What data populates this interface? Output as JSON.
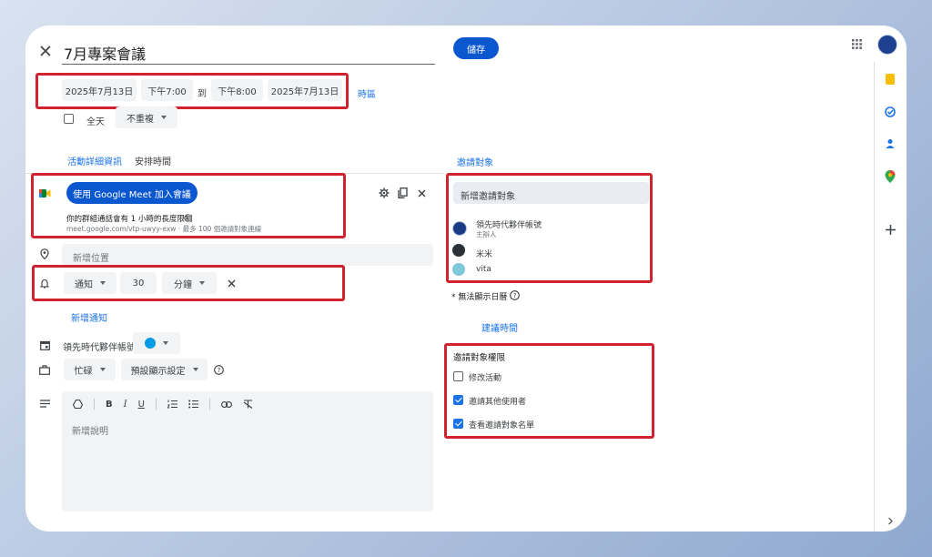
{
  "header": {
    "title": "7月專案會議",
    "save_label": "儲存"
  },
  "datetime": {
    "start_date": "2025年7月13日",
    "start_time": "下午7:00",
    "to_label": "到",
    "end_time": "下午8:00",
    "end_date": "2025年7月13日",
    "timezone_label": "時區",
    "all_day_label": "全天",
    "repeat_value": "不重複"
  },
  "tabs": {
    "details": "活動詳細資訊",
    "schedule": "安排時間"
  },
  "meet": {
    "join_button": "使用 Google Meet 加入會議",
    "limit_text": "你的群組通話會有 1 小時的長度限制",
    "link_text": "meet.google.com/vtp-uwyy-exw · 最多 100 個邀請對象連線"
  },
  "location": {
    "placeholder": "新增位置"
  },
  "notification": {
    "type": "通知",
    "amount": "30",
    "unit": "分鐘",
    "add_label": "新增通知"
  },
  "calendar": {
    "owner": "領先時代夥伴帳號",
    "color": "#039be5"
  },
  "status": {
    "busy": "忙碌",
    "visibility": "預設顯示設定"
  },
  "description": {
    "placeholder": "新增說明"
  },
  "guests": {
    "tab_label": "邀請對象",
    "add_placeholder": "新增邀請對象",
    "list": [
      {
        "name": "領先時代夥伴帳號",
        "role": "主辦人"
      },
      {
        "name": "米米",
        "role": ""
      },
      {
        "name": "vita",
        "role": ""
      }
    ],
    "calendar_notice": "* 無法顯示日曆",
    "suggest_times": "建議時間",
    "permissions_title": "邀請對象權限",
    "permissions": [
      {
        "label": "修改活動",
        "checked": false
      },
      {
        "label": "邀請其他使用者",
        "checked": true
      },
      {
        "label": "查看邀請對象名單",
        "checked": true
      }
    ]
  },
  "side_panel": {
    "icons": [
      "keep-icon",
      "tasks-icon",
      "contacts-icon",
      "maps-icon",
      "add-icon"
    ]
  }
}
